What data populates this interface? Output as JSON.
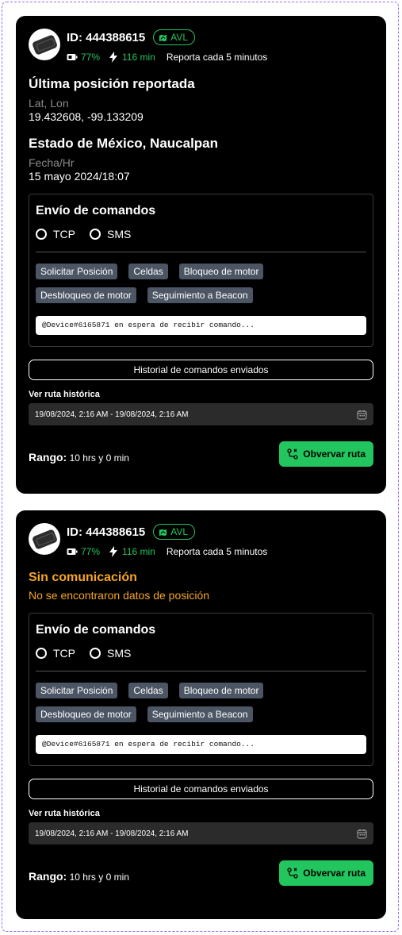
{
  "cards": [
    {
      "device_id": "ID: 444388615",
      "badge": "AVL",
      "battery": "77%",
      "duration": "116 min",
      "report": "Reporta cada 5 minutos",
      "position_title": "Última posición reportada",
      "latlon_label": "Lat, Lon",
      "latlon_value": "19.432608, -99.133209",
      "location": "Estado de México, Naucalpan",
      "datetime_label": "Fecha/Hr",
      "datetime_value": "15 mayo 2024/18:07",
      "commands_title": "Envío de comandos",
      "radio_tcp": "TCP",
      "radio_sms": "SMS",
      "chips": [
        "Solicitar Posición",
        "Celdas",
        "Bloqueo de motor",
        "Desbloqueo de motor",
        "Seguimiento a Beacon"
      ],
      "status_text": "@Device#6165871 en espera de recibir comando...",
      "history_button": "Historial de comandos enviados",
      "route_label": "Ver ruta histórica",
      "date_range": "19/08/2024, 2:16 AM - 19/08/2024, 2:16 AM",
      "range_label": "Rango:",
      "range_value": "10 hrs y 0 min",
      "observe_button": "Obvervar ruta"
    },
    {
      "device_id": "ID: 444388615",
      "badge": "AVL",
      "battery": "77%",
      "duration": "116 min",
      "report": "Reporta cada 5 minutos",
      "no_comm_title": "Sin comunicación",
      "no_comm_sub": "No se encontraron datos de posición",
      "commands_title": "Envío de comandos",
      "radio_tcp": "TCP",
      "radio_sms": "SMS",
      "chips": [
        "Solicitar Posición",
        "Celdas",
        "Bloqueo de motor",
        "Desbloqueo de motor",
        "Seguimiento a Beacon"
      ],
      "status_text": "@Device#6165871 en espera de recibir comando...",
      "history_button": "Historial de comandos enviados",
      "route_label": "Ver ruta histórica",
      "date_range": "19/08/2024, 2:16 AM - 19/08/2024, 2:16 AM",
      "range_label": "Rango:",
      "range_value": "10 hrs y 0 min",
      "observe_button": "Obvervar ruta"
    }
  ],
  "colors": {
    "accent_green": "#22c55e",
    "warning_orange": "#f5a623",
    "chip_gray": "#4b5563"
  }
}
